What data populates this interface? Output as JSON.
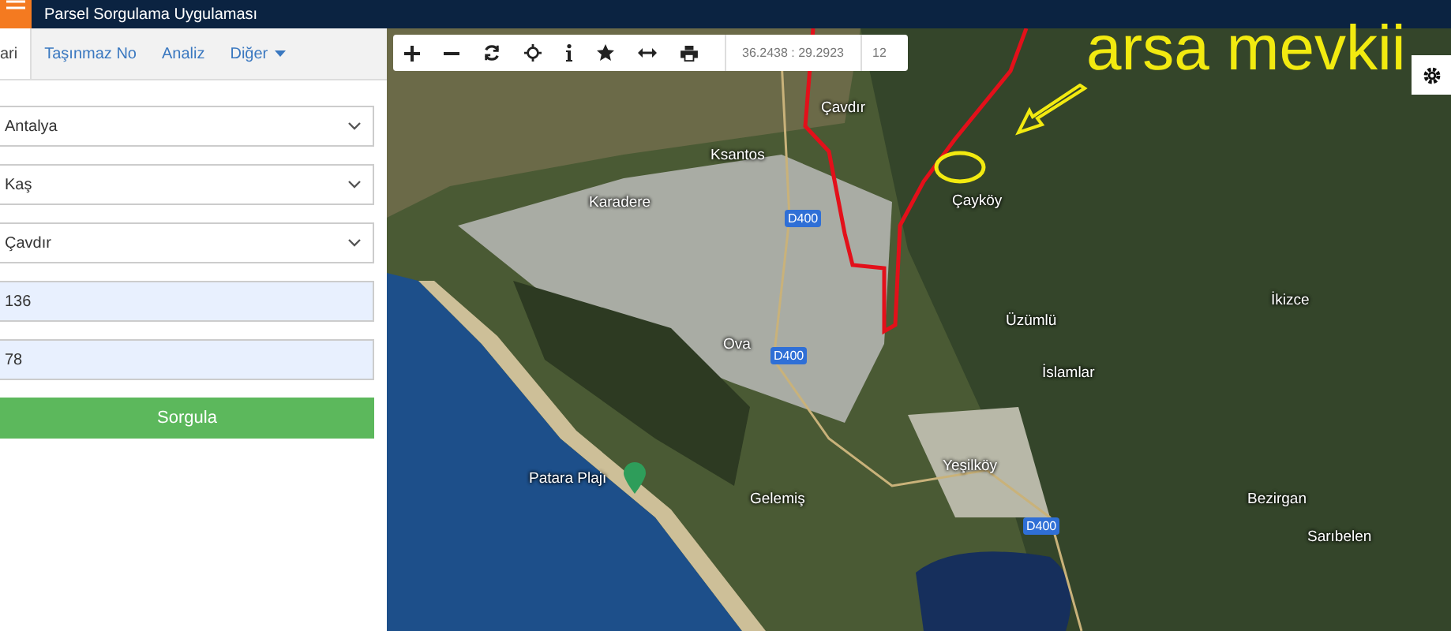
{
  "header": {
    "title": "Parsel Sorgulama Uygulaması"
  },
  "tabs": [
    {
      "label": "ari",
      "selected": true,
      "dropdown": false
    },
    {
      "label": "Taşınmaz No",
      "selected": false,
      "dropdown": false
    },
    {
      "label": "Analiz",
      "selected": false,
      "dropdown": false
    },
    {
      "label": "Diğer",
      "selected": false,
      "dropdown": true
    }
  ],
  "form": {
    "fields": [
      {
        "kind": "select",
        "value": "Antalya"
      },
      {
        "kind": "select",
        "value": "Kaş"
      },
      {
        "kind": "select",
        "value": "Çavdır"
      },
      {
        "kind": "input",
        "value": "136"
      },
      {
        "kind": "input",
        "value": "78"
      }
    ],
    "submit": "Sorgula"
  },
  "map": {
    "toolbar": {
      "coordinates": "36.2438 : 29.2923",
      "zoom": "12"
    },
    "annotation": "arsa mevkii",
    "labels": [
      {
        "kind": "place",
        "text": "Çavdır"
      },
      {
        "kind": "place",
        "text": "Ksantos"
      },
      {
        "kind": "place",
        "text": "Karadere"
      },
      {
        "kind": "road",
        "text": "D400"
      },
      {
        "kind": "place",
        "text": "Çayköy"
      },
      {
        "kind": "place",
        "text": "İkizce"
      },
      {
        "kind": "place",
        "text": "Üzümlü"
      },
      {
        "kind": "place",
        "text": "Ova"
      },
      {
        "kind": "road",
        "text": "D400"
      },
      {
        "kind": "place",
        "text": "İslamlar"
      },
      {
        "kind": "place",
        "text": "Yeşilköy"
      },
      {
        "kind": "poi",
        "text": "Patara Plajı"
      },
      {
        "kind": "place",
        "text": "Gelemiş"
      },
      {
        "kind": "place",
        "text": "Bezirgan"
      },
      {
        "kind": "road",
        "text": "D400"
      },
      {
        "kind": "place",
        "text": "Sarıbelen"
      }
    ]
  }
}
